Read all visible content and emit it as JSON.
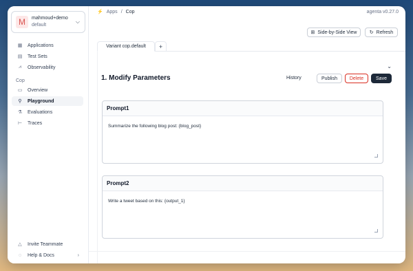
{
  "account": {
    "name": "mahmoud+demo",
    "workspace": "default",
    "avatar_letter": "M"
  },
  "sidebar": {
    "items": [
      {
        "label": "Applications",
        "icon": "grid-icon"
      },
      {
        "label": "Test Sets",
        "icon": "document-icon"
      },
      {
        "label": "Observability",
        "icon": "chart-icon"
      }
    ],
    "section": "Cop",
    "app_items": [
      {
        "label": "Overview",
        "icon": "monitor-icon"
      },
      {
        "label": "Playground",
        "icon": "rocket-icon",
        "active": true
      },
      {
        "label": "Evaluations",
        "icon": "flask-icon"
      },
      {
        "label": "Traces",
        "icon": "hierarchy-icon"
      }
    ],
    "footer": [
      {
        "label": "Invite Teammate",
        "icon": "warning-icon"
      },
      {
        "label": "Help & Docs",
        "icon": "help-icon"
      }
    ]
  },
  "header": {
    "breadcrumb": [
      "Apps",
      "Cop"
    ],
    "version": "agenta v0.27.0",
    "side_by_side_label": "Side-by-Side View",
    "refresh_label": "Refresh"
  },
  "tabs": [
    {
      "label": "Variant cop.default"
    }
  ],
  "main": {
    "title": "1. Modify Parameters",
    "history_label": "History",
    "publish_label": "Publish",
    "delete_label": "Delete",
    "save_label": "Save"
  },
  "prompts": [
    {
      "title": "Prompt1",
      "text": "Summarize the following blog post: {blog_post}"
    },
    {
      "title": "Prompt2",
      "text": "Write a tweet based on this: {output_1}"
    }
  ],
  "colors": {
    "delete": "#d92d20",
    "save_bg": "#1d2939",
    "active_nav_bg": "#f2f4f7"
  }
}
